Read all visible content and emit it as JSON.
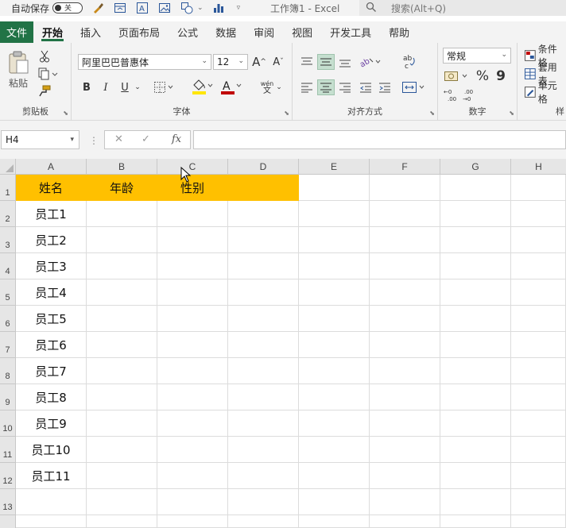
{
  "titlebar": {
    "autosave_label": "自动保存",
    "autosave_state": "关",
    "doc_title": "工作簿1 - Excel",
    "search_placeholder": "搜索(Alt+Q)",
    "quick_icons": [
      "brush-icon",
      "layout-icon",
      "text-frame-icon",
      "picture-icon",
      "shapes-icon",
      "bar-chart-icon"
    ]
  },
  "tabs": {
    "file": "文件",
    "items": [
      "开始",
      "插入",
      "页面布局",
      "公式",
      "数据",
      "审阅",
      "视图",
      "开发工具",
      "帮助"
    ],
    "active_index": 0
  },
  "ribbon": {
    "clipboard": {
      "label": "剪贴板",
      "paste": "粘贴"
    },
    "font": {
      "label": "字体",
      "font_name": "阿里巴巴普惠体",
      "font_size": "12",
      "bold": "B",
      "italic": "I",
      "underline": "U",
      "grow": "A^",
      "shrink": "Aˇ",
      "font_color": "A",
      "phonetic": "wén"
    },
    "alignment": {
      "label": "对齐方式"
    },
    "number": {
      "label": "数字",
      "format": "常规",
      "percent": "%",
      "comma": "9",
      "inc_decimal": ".00",
      "dec_decimal": ".00"
    },
    "styles": {
      "label": "样",
      "conditional": "条件格",
      "table": "套用表",
      "cell": "单元格"
    }
  },
  "formula_bar": {
    "name_box": "H4",
    "fx": "fx",
    "formula": ""
  },
  "sheet": {
    "columns": [
      "A",
      "B",
      "C",
      "D",
      "E",
      "F",
      "G",
      "H"
    ],
    "rows": [
      "1",
      "2",
      "3",
      "4",
      "5",
      "6",
      "7",
      "8",
      "9",
      "10",
      "11",
      "12",
      "13"
    ],
    "header_row": [
      "姓名",
      "年龄",
      "性别",
      ""
    ],
    "col_a": [
      "员工1",
      "员工2",
      "员工3",
      "员工4",
      "员工5",
      "员工6",
      "员工7",
      "员工8",
      "员工9",
      "员工10",
      "员工11"
    ],
    "header_fill": "#ffc000"
  },
  "colors": {
    "brand": "#217346",
    "selected_button": "#c5dfcf"
  }
}
